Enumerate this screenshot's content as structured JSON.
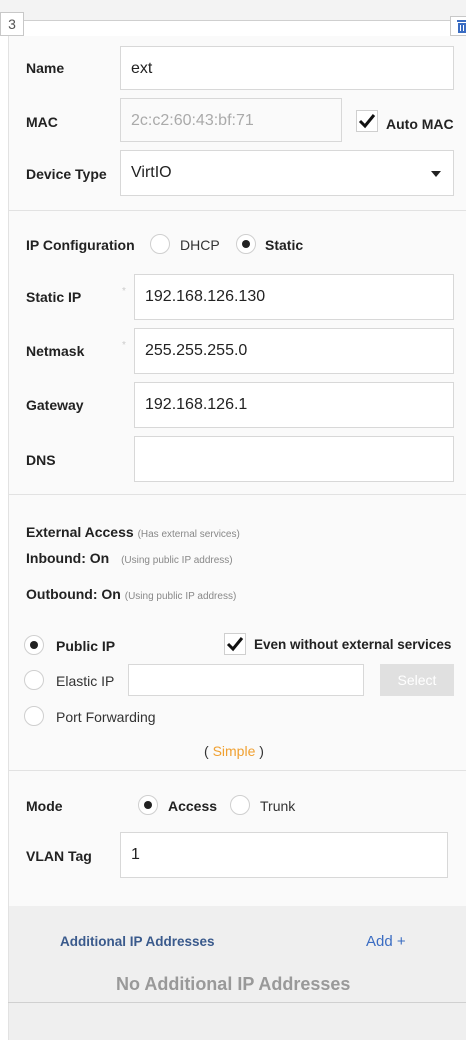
{
  "tab_number": "3",
  "fields": {
    "name": {
      "label": "Name",
      "value": "ext"
    },
    "mac": {
      "label": "MAC",
      "value": "2c:c2:60:43:bf:71",
      "auto_label": "Auto MAC",
      "auto_checked": true
    },
    "device_type": {
      "label": "Device Type",
      "value": "VirtIO"
    }
  },
  "ip_config": {
    "label": "IP Configuration",
    "options": [
      {
        "label": "DHCP",
        "selected": false
      },
      {
        "label": "Static",
        "selected": true
      }
    ],
    "static_ip": {
      "label": "Static IP",
      "value": "192.168.126.130"
    },
    "netmask": {
      "label": "Netmask",
      "value": "255.255.255.0"
    },
    "gateway": {
      "label": "Gateway",
      "value": "192.168.126.1"
    },
    "dns": {
      "label": "DNS",
      "value": ""
    }
  },
  "external": {
    "title": "External Access",
    "title_note": "(Has external services)",
    "inbound": "Inbound: On",
    "inbound_note": "(Using public IP address)",
    "outbound": "Outbound: On",
    "outbound_note": "(Using public IP address)",
    "public_ip": {
      "label": "Public IP",
      "selected": true
    },
    "even_without": {
      "label": "Even without external services",
      "checked": true
    },
    "elastic_ip": {
      "label": "Elastic IP",
      "selected": false,
      "value": "",
      "button": "Select"
    },
    "port_forwarding": {
      "label": "Port Forwarding",
      "selected": false
    },
    "simple_open": "(",
    "simple_link": "Simple",
    "simple_close": ")"
  },
  "mode": {
    "label": "Mode",
    "options": [
      {
        "label": "Access",
        "selected": true
      },
      {
        "label": "Trunk",
        "selected": false
      }
    ]
  },
  "vlan": {
    "label": "VLAN Tag",
    "value": "1"
  },
  "additional": {
    "title": "Additional IP Addresses",
    "add": "Add +",
    "empty": "No Additional IP Addresses"
  },
  "icons": {
    "trash": "trash-icon",
    "check": "check-icon",
    "caret": "caret-down-icon"
  }
}
